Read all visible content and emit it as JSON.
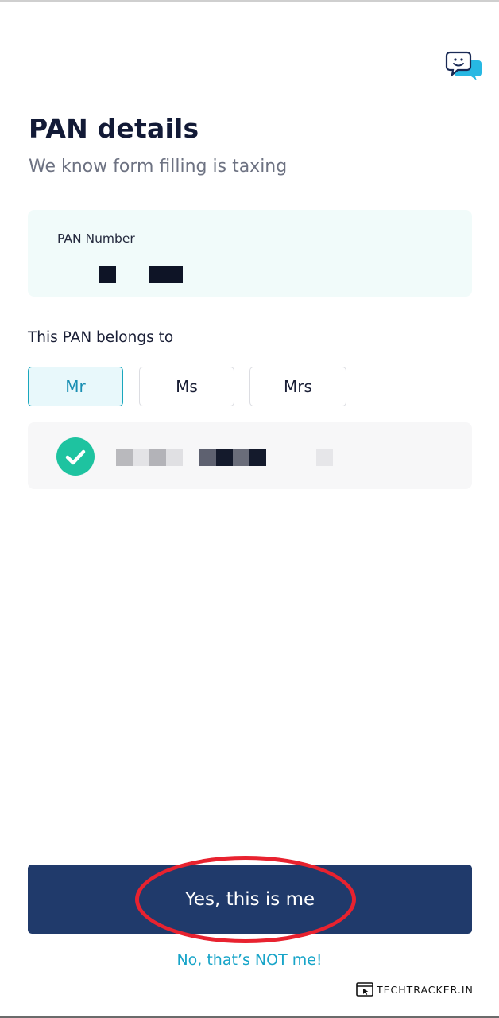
{
  "header": {
    "chat_icon": "chat-support-icon"
  },
  "page": {
    "title": "PAN details",
    "subtitle": "We know form filling is taxing"
  },
  "pan": {
    "label": "PAN Number",
    "value_redacted": true
  },
  "belongs": {
    "label": "This PAN belongs to",
    "options": [
      "Mr",
      "Ms",
      "Mrs"
    ],
    "selected": "Mr"
  },
  "name_match": {
    "status_icon": "check-circle-icon",
    "name_redacted": true
  },
  "actions": {
    "confirm_label": "Yes, this is me",
    "deny_label": "No, that’s NOT me!"
  },
  "watermark": {
    "text": "TECHTRACKER.IN"
  },
  "colors": {
    "primary": "#203a6b",
    "accent": "#19a7bd",
    "success": "#1ec3a0",
    "annotation": "#e8222f"
  }
}
